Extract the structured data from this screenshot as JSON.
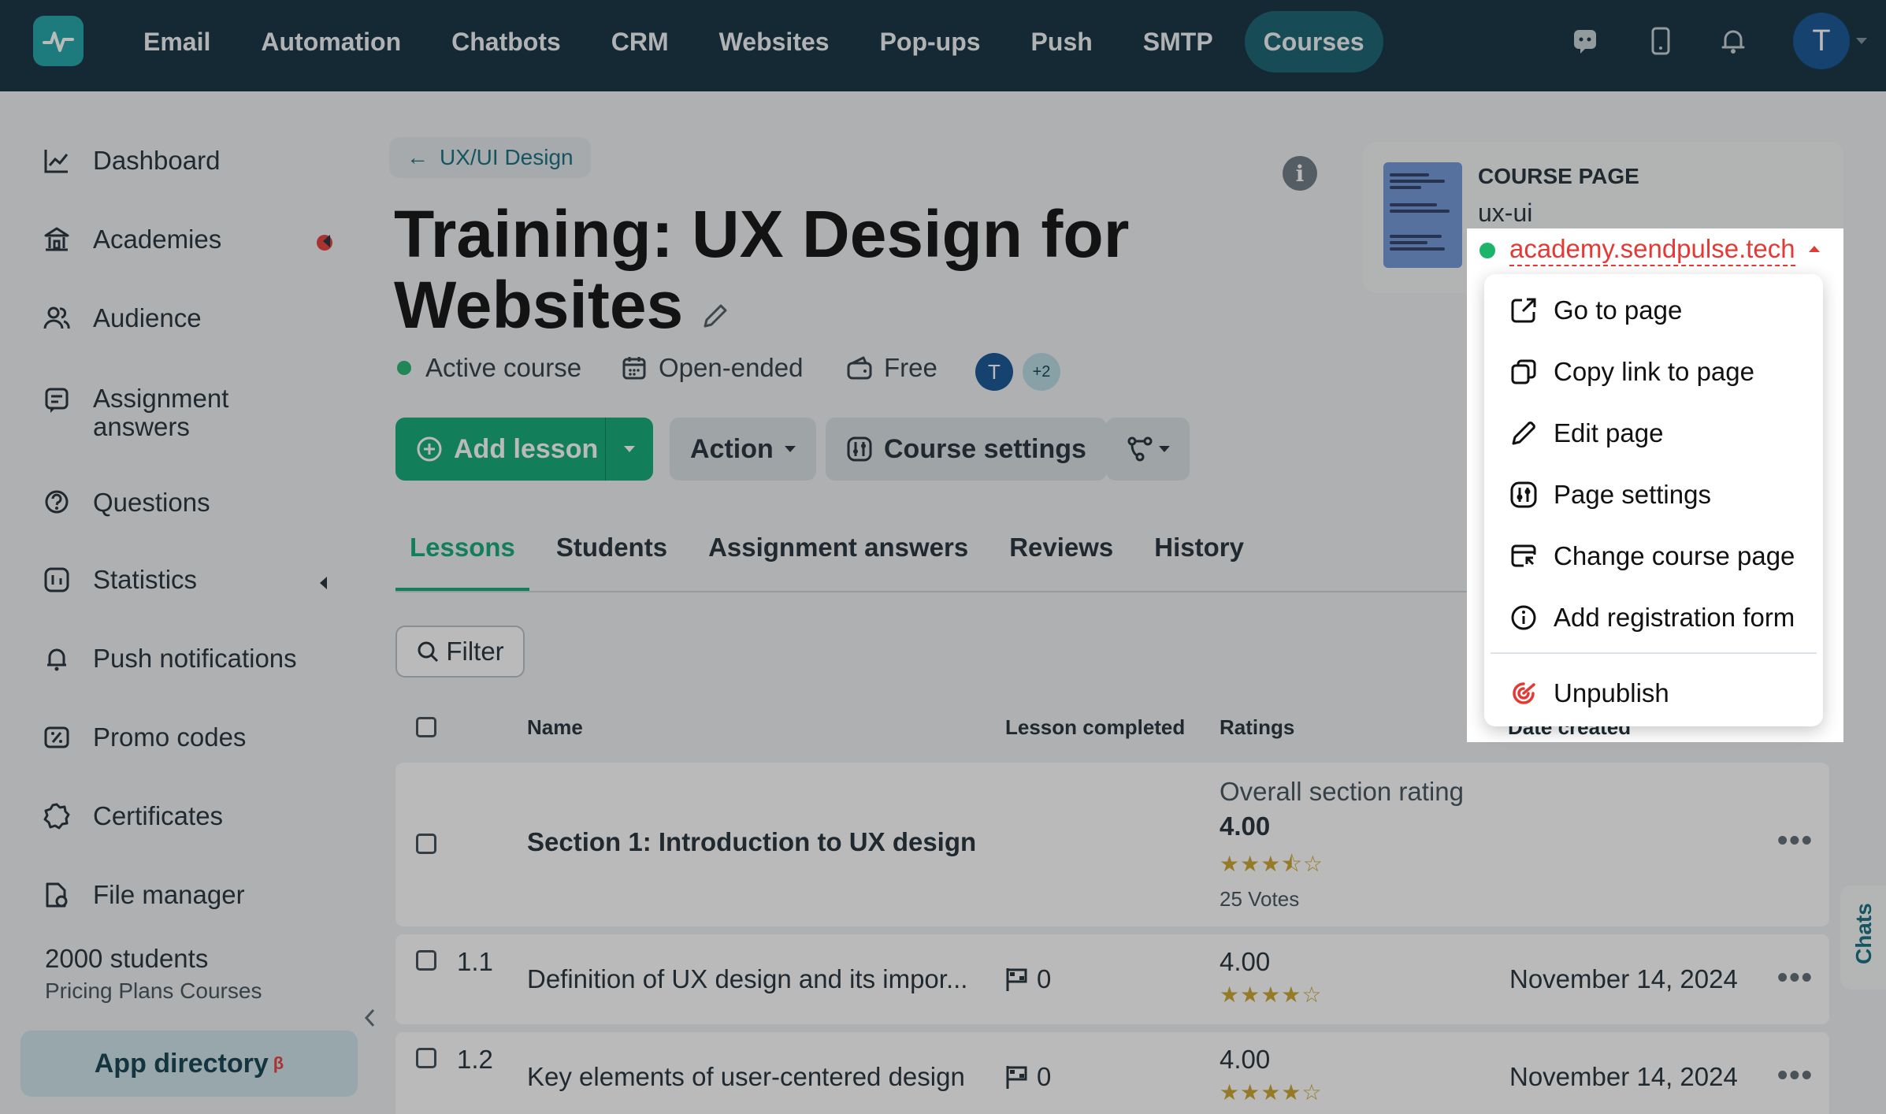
{
  "nav": {
    "items": [
      "Email",
      "Automation",
      "Chatbots",
      "CRM",
      "Websites",
      "Pop-ups",
      "Push",
      "SMTP",
      "Courses"
    ],
    "active": "Courses",
    "avatar_initial": "T",
    "icons": [
      "chat-icon",
      "mobile-icon",
      "bell-icon"
    ]
  },
  "sidebar": {
    "items": [
      {
        "label": "Dashboard",
        "icon": "chart-line-icon"
      },
      {
        "label": "Academies",
        "icon": "academy-icon"
      },
      {
        "label": "Audience",
        "icon": "users-icon"
      },
      {
        "label": "Assignment answers",
        "icon": "assignment-icon"
      },
      {
        "label": "Questions",
        "icon": "question-icon"
      },
      {
        "label": "Statistics",
        "icon": "statistics-icon"
      },
      {
        "label": "Push notifications",
        "icon": "bell-icon"
      },
      {
        "label": "Promo codes",
        "icon": "promo-icon"
      },
      {
        "label": "Certificates",
        "icon": "certificate-icon"
      },
      {
        "label": "File manager",
        "icon": "file-icon"
      }
    ],
    "plan_count": "2000 students",
    "plan_name": "Pricing Plans Courses",
    "app_directory": "App directory",
    "app_directory_badge": "β"
  },
  "main": {
    "breadcrumb": "UX/UI Design",
    "title": "Training: UX Design for Websites",
    "status": "Active course",
    "duration": "Open-ended",
    "price": "Free",
    "author_initial": "T",
    "more_authors": "+2",
    "buttons": {
      "add_lesson": "Add lesson",
      "action": "Action",
      "course_settings": "Course settings"
    },
    "tabs": [
      "Lessons",
      "Students",
      "Assignment answers",
      "Reviews",
      "History"
    ],
    "active_tab": "Lessons",
    "filter": "Filter",
    "columns": {
      "name": "Name",
      "lesson_completed": "Lesson completed",
      "ratings": "Ratings",
      "date_created": "Date created"
    },
    "section": {
      "name": "Section 1: Introduction to UX design",
      "rating_label": "Overall section rating",
      "rating": "4.00",
      "stars": "★★★⯪☆",
      "votes": "25 Votes"
    },
    "lessons": [
      {
        "num": "1.1",
        "name": "Definition of UX design and its impor...",
        "completed": "0",
        "rating": "4.00",
        "stars": "★★★★☆",
        "date": "November 14, 2024"
      },
      {
        "num": "1.2",
        "name": "Key elements of user-centered design",
        "completed": "0",
        "rating": "4.00",
        "stars": "★★★★☆",
        "date": "November 14, 2024"
      }
    ],
    "chats": "Chats"
  },
  "course_page": {
    "label": "COURSE PAGE",
    "slug": "ux-ui",
    "url": "academy.sendpulse.tech",
    "status_color": "#1cb36b",
    "link_color": "#e53935"
  },
  "menu": {
    "items": [
      {
        "label": "Go to page",
        "icon": "external-link-icon"
      },
      {
        "label": "Copy link to page",
        "icon": "copy-icon"
      },
      {
        "label": "Edit page",
        "icon": "pencil-icon"
      },
      {
        "label": "Page settings",
        "icon": "settings-sliders-icon"
      },
      {
        "label": "Change course page",
        "icon": "swap-page-icon"
      },
      {
        "label": "Add registration form",
        "icon": "info-icon"
      },
      {
        "label": "Unpublish",
        "icon": "unpublish-icon"
      }
    ]
  }
}
